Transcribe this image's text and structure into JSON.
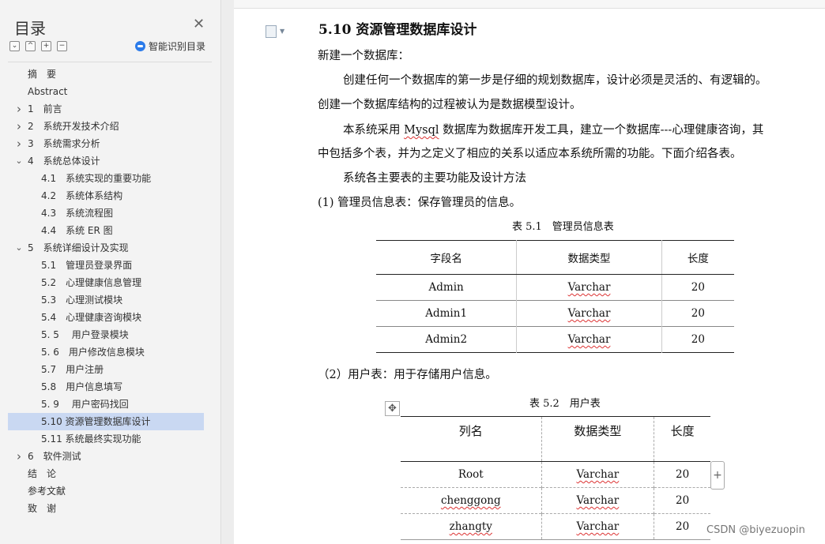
{
  "sidebar": {
    "title": "目录",
    "smart_label": "智能识别目录",
    "tools": [
      "⌄",
      "^",
      "+",
      "−"
    ],
    "items": [
      {
        "label": "摘　要",
        "indent": 0,
        "chevron": "",
        "selected": false
      },
      {
        "label": "Abstract",
        "indent": 0,
        "chevron": "",
        "selected": false
      },
      {
        "label": "1　前言",
        "indent": 0,
        "chevron": ">",
        "selected": false
      },
      {
        "label": "2　系统开发技术介绍",
        "indent": 0,
        "chevron": ">",
        "selected": false
      },
      {
        "label": "3　系统需求分析",
        "indent": 0,
        "chevron": ">",
        "selected": false
      },
      {
        "label": "4　系统总体设计",
        "indent": 0,
        "chevron": "v",
        "selected": false
      },
      {
        "label": "4.1　系统实现的重要功能",
        "indent": 1,
        "chevron": "",
        "selected": false
      },
      {
        "label": "4.2　系统体系结构",
        "indent": 1,
        "chevron": "",
        "selected": false
      },
      {
        "label": "4.3　系统流程图",
        "indent": 1,
        "chevron": "",
        "selected": false
      },
      {
        "label": "4.4　系统 ER 图",
        "indent": 1,
        "chevron": "",
        "selected": false
      },
      {
        "label": "5　系统详细设计及实现",
        "indent": 0,
        "chevron": "v",
        "selected": false
      },
      {
        "label": "5.1　管理员登录界面",
        "indent": 1,
        "chevron": "",
        "selected": false
      },
      {
        "label": "5.2　心理健康信息管理",
        "indent": 1,
        "chevron": "",
        "selected": false
      },
      {
        "label": "5.3　心理测试模块",
        "indent": 1,
        "chevron": "",
        "selected": false
      },
      {
        "label": "5.4　心理健康咨询模块",
        "indent": 1,
        "chevron": "",
        "selected": false
      },
      {
        "label": "5. 5　 用户登录模块",
        "indent": 1,
        "chevron": "",
        "selected": false
      },
      {
        "label": "5. 6　用户修改信息模块",
        "indent": 1,
        "chevron": "",
        "selected": false
      },
      {
        "label": "5.7　用户注册",
        "indent": 1,
        "chevron": "",
        "selected": false
      },
      {
        "label": "5.8　用户信息填写",
        "indent": 1,
        "chevron": "",
        "selected": false
      },
      {
        "label": "5. 9　 用户密码找回",
        "indent": 1,
        "chevron": "",
        "selected": false
      },
      {
        "label": "5.10  资源管理数据库设计",
        "indent": 1,
        "chevron": "",
        "selected": true
      },
      {
        "label": "5.11  系统最终实现功能",
        "indent": 1,
        "chevron": "",
        "selected": false
      },
      {
        "label": "6　软件测试",
        "indent": 0,
        "chevron": ">",
        "selected": false
      },
      {
        "label": "结　论",
        "indent": 0,
        "chevron": "",
        "selected": false
      },
      {
        "label": "参考文献",
        "indent": 0,
        "chevron": "",
        "selected": false
      },
      {
        "label": "致　谢",
        "indent": 0,
        "chevron": "",
        "selected": false
      }
    ]
  },
  "doc": {
    "heading": "5.10  资源管理数据库设计",
    "p1": "新建一个数据库：",
    "p2a": "创建任何一个数据库的第一步是仔细的规划数据库，设计必须是灵活的、有逻辑的。",
    "p2b": "创建一个数据库结构的过程被认为是数据模型设计。",
    "p3a_pre": "本系统采用 ",
    "p3a_mysql": "Mysql",
    "p3a_post": " 数据库为数据库开发工具，建立一个数据库---心理健康咨询，其",
    "p3b": "中包括多个表，并为之定义了相应的关系以适应本系统所需的功能。下面介绍各表。",
    "p4": "系统各主要表的主要功能及设计方法",
    "p5": "(1) 管理员信息表：保存管理员的信息。",
    "caption1": "表 5.1　管理员信息表",
    "table1": {
      "headers": [
        "字段名",
        "数据类型",
        "长度"
      ],
      "rows": [
        [
          "Admin",
          "Varchar",
          "20"
        ],
        [
          "Admin1",
          "Varchar",
          "20"
        ],
        [
          "Admin2",
          "Varchar",
          "20"
        ]
      ]
    },
    "p6": "（2）用户表：用于存储用户信息。",
    "caption2": "表 5.2　用户表",
    "table2": {
      "headers": [
        "列名",
        "数据类型",
        "长度"
      ],
      "rows": [
        [
          "Root",
          "Varchar",
          "20"
        ],
        [
          "chenggong",
          "Varchar",
          "20"
        ],
        [
          "zhangty",
          "Varchar",
          "20"
        ]
      ]
    }
  },
  "watermark": "CSDN @biyezuopin",
  "icons": {
    "close": "close-icon",
    "smart": "smart-recognize-icon",
    "doc": "document-icon",
    "move": "move-icon",
    "add": "add-icon"
  }
}
